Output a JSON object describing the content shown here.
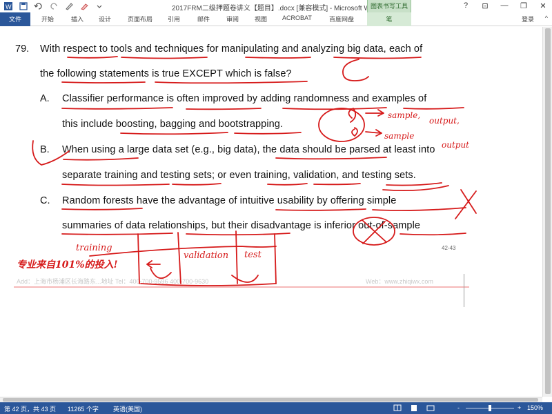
{
  "window": {
    "title": "2017FRM二级押题卷讲义【题目】.docx [兼容模式] - Microsoft Word",
    "contextual_tab_group": "图表书写工具",
    "controls": [
      "?",
      "⊡",
      "—",
      "❐",
      "✕"
    ]
  },
  "quick_access": {
    "icons": [
      "word-app-icon",
      "save-icon",
      "undo-icon",
      "redo-icon",
      "pen-icon",
      "highlighter-icon",
      "dropdown-icon"
    ]
  },
  "ribbon": {
    "file_tab": "文件",
    "tabs": [
      "开始",
      "插入",
      "设计",
      "页面布局",
      "引用",
      "邮件",
      "审阅",
      "视图",
      "ACROBAT",
      "百度网盘"
    ],
    "contextual_tab": "笔",
    "signin": "登录",
    "collapse": "^"
  },
  "document": {
    "question": {
      "number": "79.",
      "line1": "With respect to tools and techniques for manipulating and analyzing big data, each of",
      "line2": "the following statements is true EXCEPT which is false?"
    },
    "options": [
      {
        "letter": "A.",
        "line1": "Classifier performance is often improved by adding randomness and examples of",
        "line2": "this include boosting, bagging and bootstrapping."
      },
      {
        "letter": "B.",
        "line1": "When using a large data set (e.g., big data), the data should be parsed at least into",
        "line2": "separate training and testing sets; or even training, validation, and testing sets."
      },
      {
        "letter": "C.",
        "line1": "Random forests have the advantage of intuitive usability by offering simple",
        "line2": "summaries of data relationships, but their disadvantage is inferior out-of-sample"
      }
    ],
    "page_ref": "42-43",
    "footer_left": "Add：上海市杨浦区长海路东...地址 Tel：400-700-9596 400-700-9630",
    "footer_right": "Web：www.zhiqiwx.com",
    "footer_slogan": "专业来自101%的投入!",
    "handwriting": {
      "answer": "C",
      "sample1": "sample,",
      "output1": "output,",
      "sample2": "sample",
      "output2": "output",
      "training": "training",
      "validation": "validation",
      "test": "test"
    }
  },
  "statusbar": {
    "page": "第 42 页，共 43 页",
    "words": "11265 个字",
    "language": "英语(美国)",
    "zoom_minus": "-",
    "zoom_plus": "+",
    "zoom": "150%",
    "zoom_level": 0.5,
    "accent": "#2b579a"
  },
  "colors": {
    "ink": "#d61a1a",
    "word_blue": "#2b579a"
  }
}
